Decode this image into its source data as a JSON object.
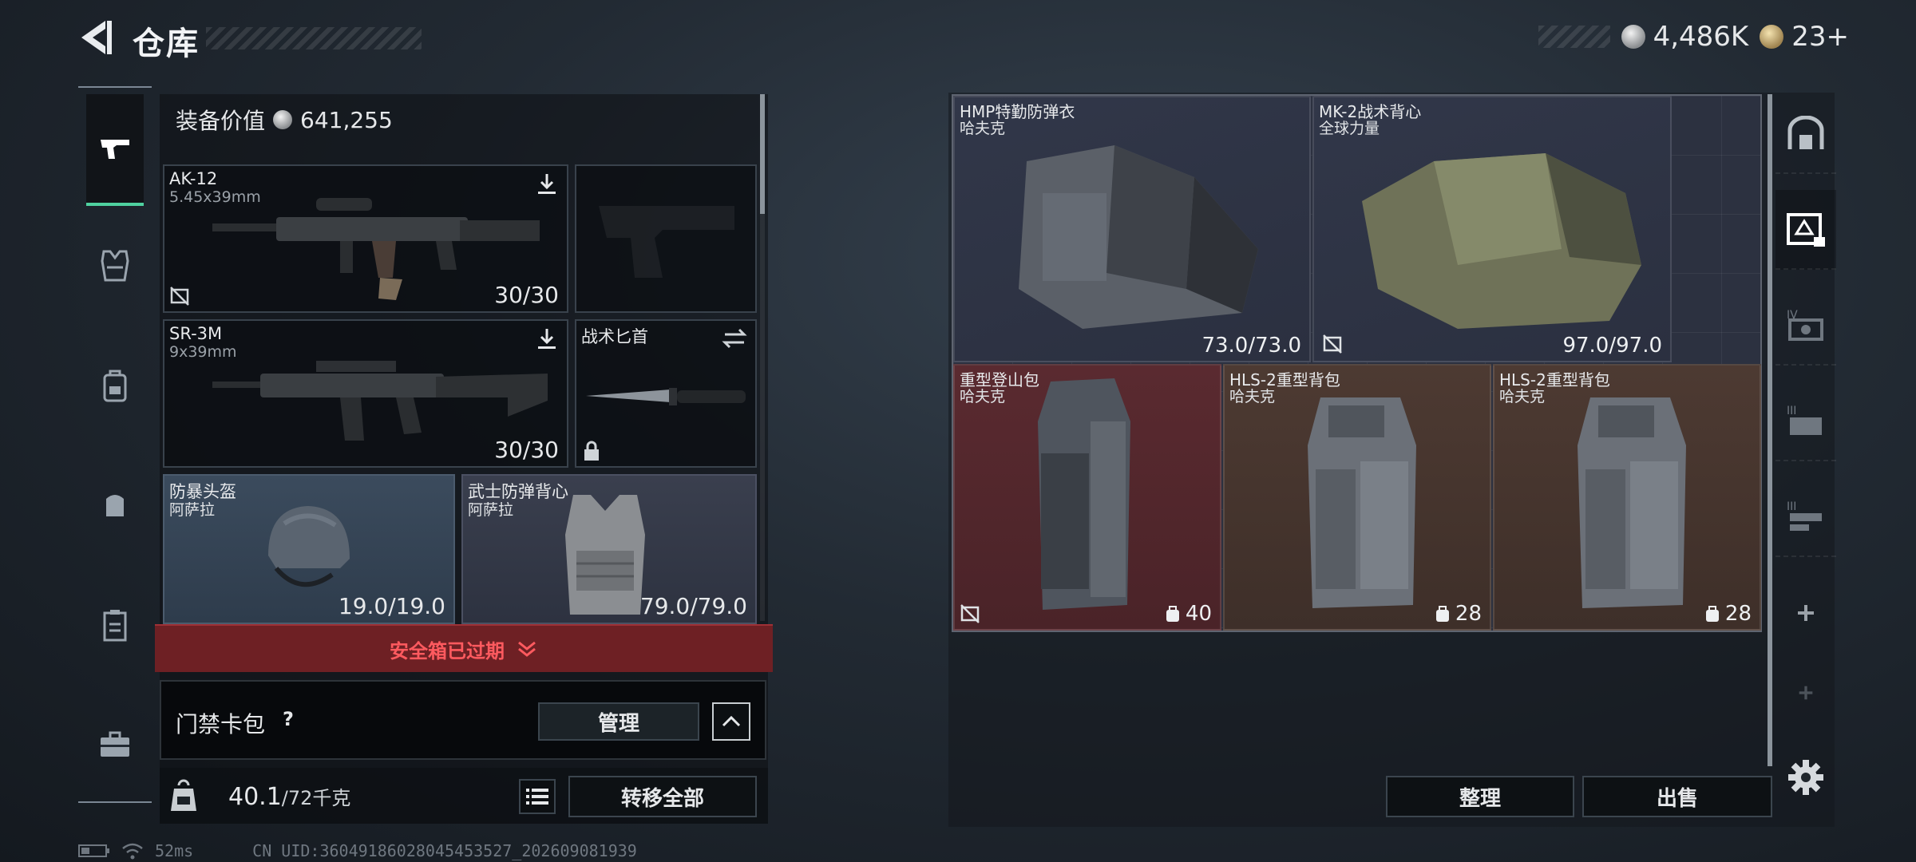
{
  "header": {
    "title": "仓库",
    "currency_silver": "4,486K",
    "currency_gold": "23+"
  },
  "equipment": {
    "value_label": "装备价值",
    "value": "641,255",
    "primary_weapon": {
      "name": "AK-12",
      "caliber": "5.45x39mm",
      "ammo": "30/30"
    },
    "secondary_weapon": {
      "name": "SR-3M",
      "caliber": "9x39mm",
      "ammo": "30/30"
    },
    "melee": {
      "name": "战术匕首"
    },
    "helmet": {
      "name": "防暴头盔",
      "brand": "阿萨拉",
      "durability": "19.0/19.0"
    },
    "armor": {
      "name": "武士防弹背心",
      "brand": "阿萨拉",
      "durability": "79.0/79.0"
    },
    "safebox_status": "安全箱已过期",
    "card_wallet_label": "门禁卡包",
    "help_label": "?",
    "manage_button": "管理",
    "weight_current": "40.1",
    "weight_max": "/72千克",
    "transfer_all_button": "转移全部"
  },
  "storage": {
    "items": [
      {
        "name": "HMP特勤防弹衣",
        "brand": "哈夫克",
        "value": "73.0/73.0"
      },
      {
        "name": "MK-2战术背心",
        "brand": "全球力量",
        "value": "97.0/97.0"
      },
      {
        "name": "重型登山包",
        "brand": "哈夫克",
        "capacity": "40"
      },
      {
        "name": "HLS-2重型背包",
        "brand": "哈夫克",
        "capacity": "28"
      },
      {
        "name": "HLS-2重型背包",
        "brand": "哈夫克",
        "capacity": "28"
      }
    ],
    "sort_button": "整理",
    "sell_button": "出售"
  },
  "status_bar": {
    "ping": "52ms",
    "uid": "CN UID:3604918602804545352​7_202609081939"
  },
  "colors": {
    "accent_green": "#4fd1a0",
    "alert_red": "#ff5a5f"
  },
  "icons": {
    "back": "chevron-left-icon",
    "silver_coin": "silver-coin-icon",
    "gold_coin": "gold-coin-icon",
    "settings": "gear-icon"
  }
}
